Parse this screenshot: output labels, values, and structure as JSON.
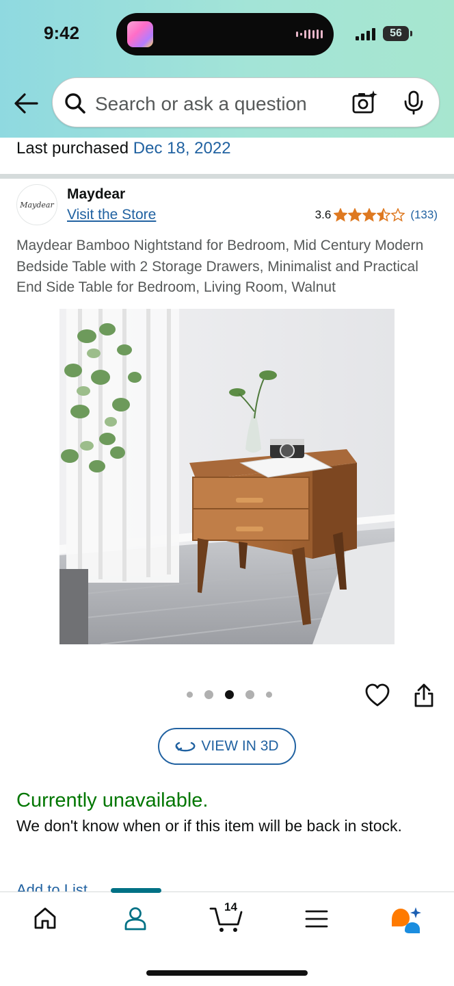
{
  "status_bar": {
    "time": "9:42",
    "battery": "56"
  },
  "search": {
    "placeholder": "Search or ask a question"
  },
  "purchase": {
    "label": "Last purchased",
    "date": "Dec 18, 2022"
  },
  "brand": {
    "logo_text": "Maydear",
    "name": "Maydear",
    "store_link": "Visit the Store"
  },
  "rating": {
    "value": "3.6",
    "stars": 3.5,
    "count": "(133)"
  },
  "product": {
    "title": "Maydear Bamboo Nightstand for Bedroom, Mid Century Modern Bedside Table with 2 Storage Drawers, Minimalist and Practical End Side Table for Bedroom, Living Room, Walnut",
    "image_count": 5,
    "active_image": 3
  },
  "actions": {
    "view_3d": "VIEW IN 3D",
    "add_to_list": "Add to List"
  },
  "availability": {
    "status": "Currently unavailable.",
    "note": "We don't know when or if this item will be back in stock."
  },
  "bottom_nav": {
    "items": [
      {
        "icon": "home-icon"
      },
      {
        "icon": "account-icon",
        "active": true
      },
      {
        "icon": "cart-icon",
        "count": "14"
      },
      {
        "icon": "menu-icon"
      },
      {
        "icon": "rufus-assistant-icon"
      }
    ]
  },
  "colors": {
    "link": "#2162a1",
    "star": "#de7921",
    "available": "#007600",
    "active_tab": "#007185"
  }
}
